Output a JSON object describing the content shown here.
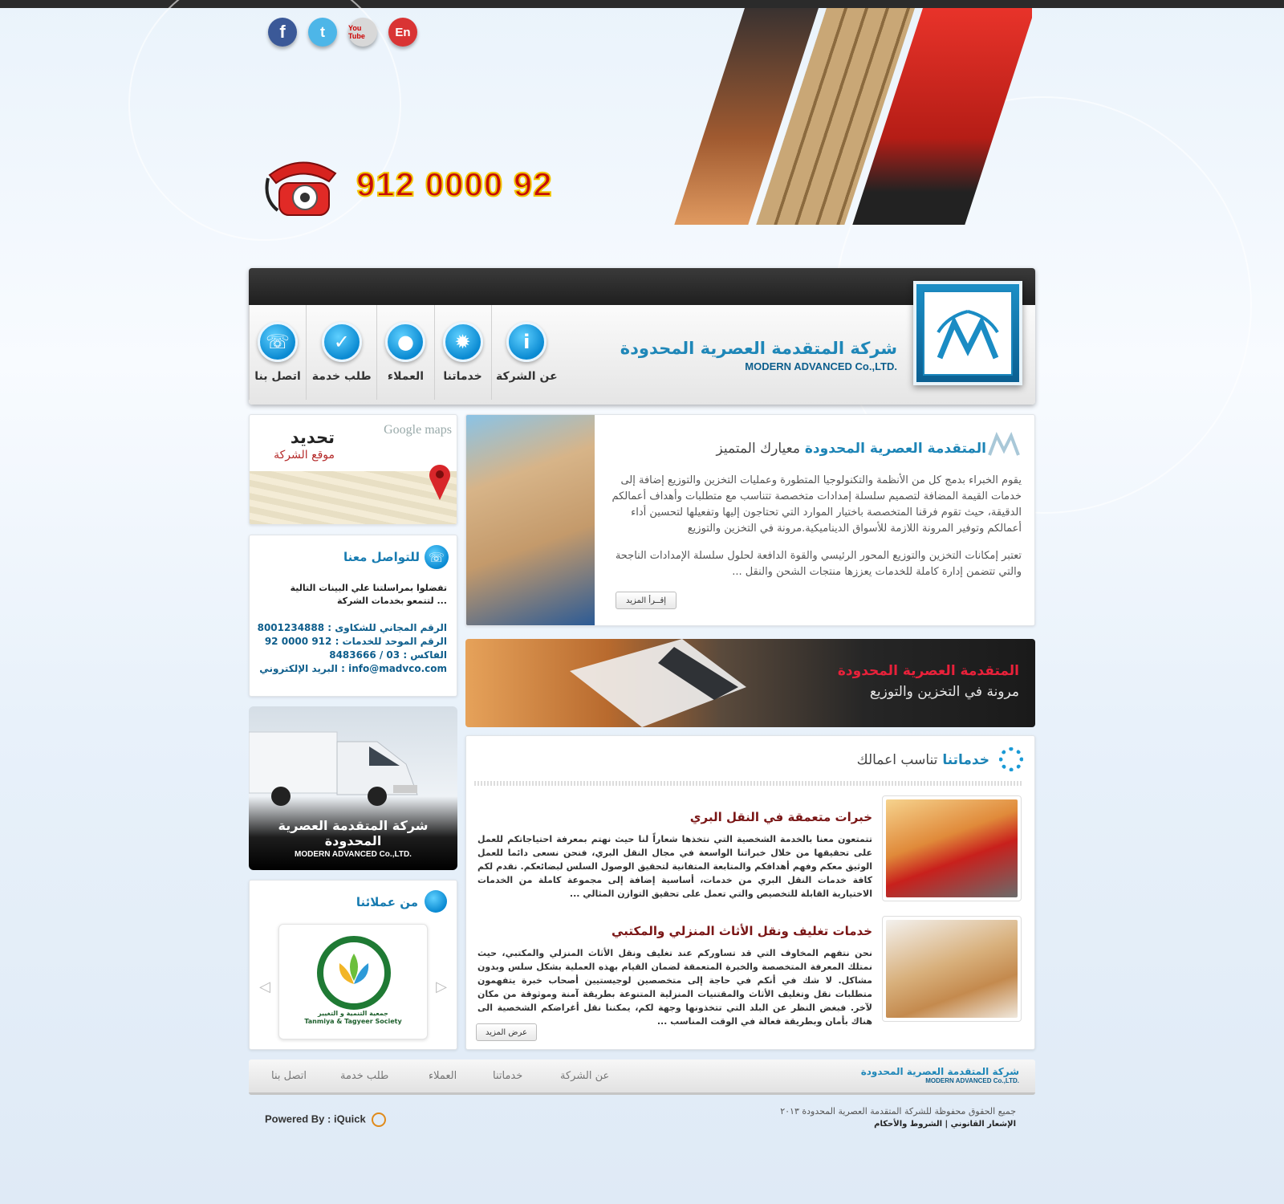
{
  "social": {
    "facebook": "f",
    "twitter": "t",
    "youtube": "You Tube",
    "english": "En"
  },
  "phone": {
    "number": "912 0000 92"
  },
  "brand": {
    "name_ar": "شركة المتقدمة العصرية المحدودة",
    "name_en": "MODERN ADVANCED Co.,LTD."
  },
  "nav": {
    "about": "عن الشركة",
    "services": "خدماتنا",
    "clients": "العملاء",
    "request": "طلب خدمة",
    "contact": "اتصل بنا"
  },
  "map": {
    "title": "تحديد",
    "subtitle": "موقع الشركة",
    "provider": "Google maps"
  },
  "contact": {
    "title": "للتواصل معنا",
    "intro": "تفضلوا بمراسلتنا علي البينات التالية لتتمعو بخدمات الشركة ...",
    "free_label": "الرقم المجاني للشكاوى :",
    "free_value": "8001234888",
    "unified_label": "الرقم الموحد للخدمات :",
    "unified_value": "912 0000 92",
    "fax_label": "الفاكس :",
    "fax_value": "03 / 8483666",
    "email_label": "البريد الإلكتروني :",
    "email_value": "info@madvco.com"
  },
  "truck_card": {
    "name_ar": "شركة المتقدمة العصرية المحدودة",
    "name_en": "MODERN ADVANCED Co.,LTD."
  },
  "clients": {
    "title": "من عملائنا",
    "client_name_ar": "جمعية التنمية و التغيير",
    "client_name_en": "Tanmiya & Tagyeer Society"
  },
  "about": {
    "title": "المتقدمة العصرية المحدودة",
    "subtitle": "معيارك المتميز",
    "p1": "يقوم الخبراء بدمج كل من الأنظمة والتكنولوجيا المتطورة وعمليات التخزين والتوزيع إضافة إلى خدمات القيمة المضافة لتصميم سلسلة إمدادات متخصصة تتناسب مع متطلبات وأهداف أعمالكم الدقيقة، حيث تقوم فرقنا المتخصصة باختيار الموارد التي تحتاجون إليها وتفعيلها لتحسين أداء أعمالكم وتوفير المرونة اللازمة للأسواق الديناميكية.مرونة في التخزين والتوزيع",
    "p2": "تعتبر إمكانات التخزين والتوزيع المحور الرئيسي والقوة الدافعة لحلول سلسلة الإمدادات الناجحة والتي تتضمن إدارة كاملة للخدمات يعززها منتجات الشحن والنقل ...",
    "read_more": "إقــرأ المزيد"
  },
  "banner": {
    "line1": "المتقدمة العصرية المحدودة",
    "line2": "مرونة في التخزين والتوزيع"
  },
  "services": {
    "title": "خدماتنا",
    "subtitle": "تناسب اعمالك",
    "items": [
      {
        "title": "خبرات متعمقة في النقل البري",
        "text": "تتمتعون معنا بالخدمة الشخصية التي نتخذها شعاراً لنا حيث نهتم بمعرفة احتياجاتكم للعمل على تحقيقها من خلال خبراتنا الواسعة في مجال النقل البري، فنحن نسعى دائما للعمل الوثيق معكم وفهم أهدافكم والمتابعة المتفانية لتحقيق الوصول السلس لبضائعكم. نقدم لكم كافة خدمات النقل البري من خدمات، أساسية إضافة إلى مجموعة كاملة من الخدمات الاختيارية القابلة للتخصيص والتي تعمل على تحقيق التوازن المثالي ..."
      },
      {
        "title": "خدمات تغليف ونقل الأثاث المنزلي والمكتبي",
        "text": "نحن نتفهم المخاوف التي قد تساوركم عند تغليف ونقل الأثاث المنزلي والمكتبي، حيث نمتلك المعرفة المتخصصة والخبرة المتعمقة لضمان القيام بهذه العملية بشكل سلس وبدون مشاكل. لا شك في أنكم في حاجة إلى متخصصين لوجيستيين أصحاب خبرة يتفهمون متطلبات نقل وتغليف الأثاث والمقتنيات المنزلية المتنوعة بطريقة آمنة وموثوقة من مكان لآخر. فبغض النظر عن البلد التي تتخذونها وجهة لكم، يمكننا نقل أغراضكم الشخصية الى هناك بأمان وبطريقة فعالة في الوقت المناسب ..."
      }
    ],
    "show_more": "عرض المزيد"
  },
  "footer": {
    "about": "عن الشركة",
    "services": "خدماتنا",
    "clients": "العملاء",
    "request": "طلب خدمة",
    "contact": "اتصل بنا",
    "brand_ar": "شركة المتقدمة العصرية المحدودة",
    "brand_en": "MODERN ADVANCED Co.,LTD.",
    "powered": "Powered By : iQuick",
    "copyright": "جميع الحقوق محفوظة للشركة المتقدمة العصرية المحدودة ٢٠١٣",
    "legal": "الإشعار القانوني | الشروط والأحكام"
  }
}
